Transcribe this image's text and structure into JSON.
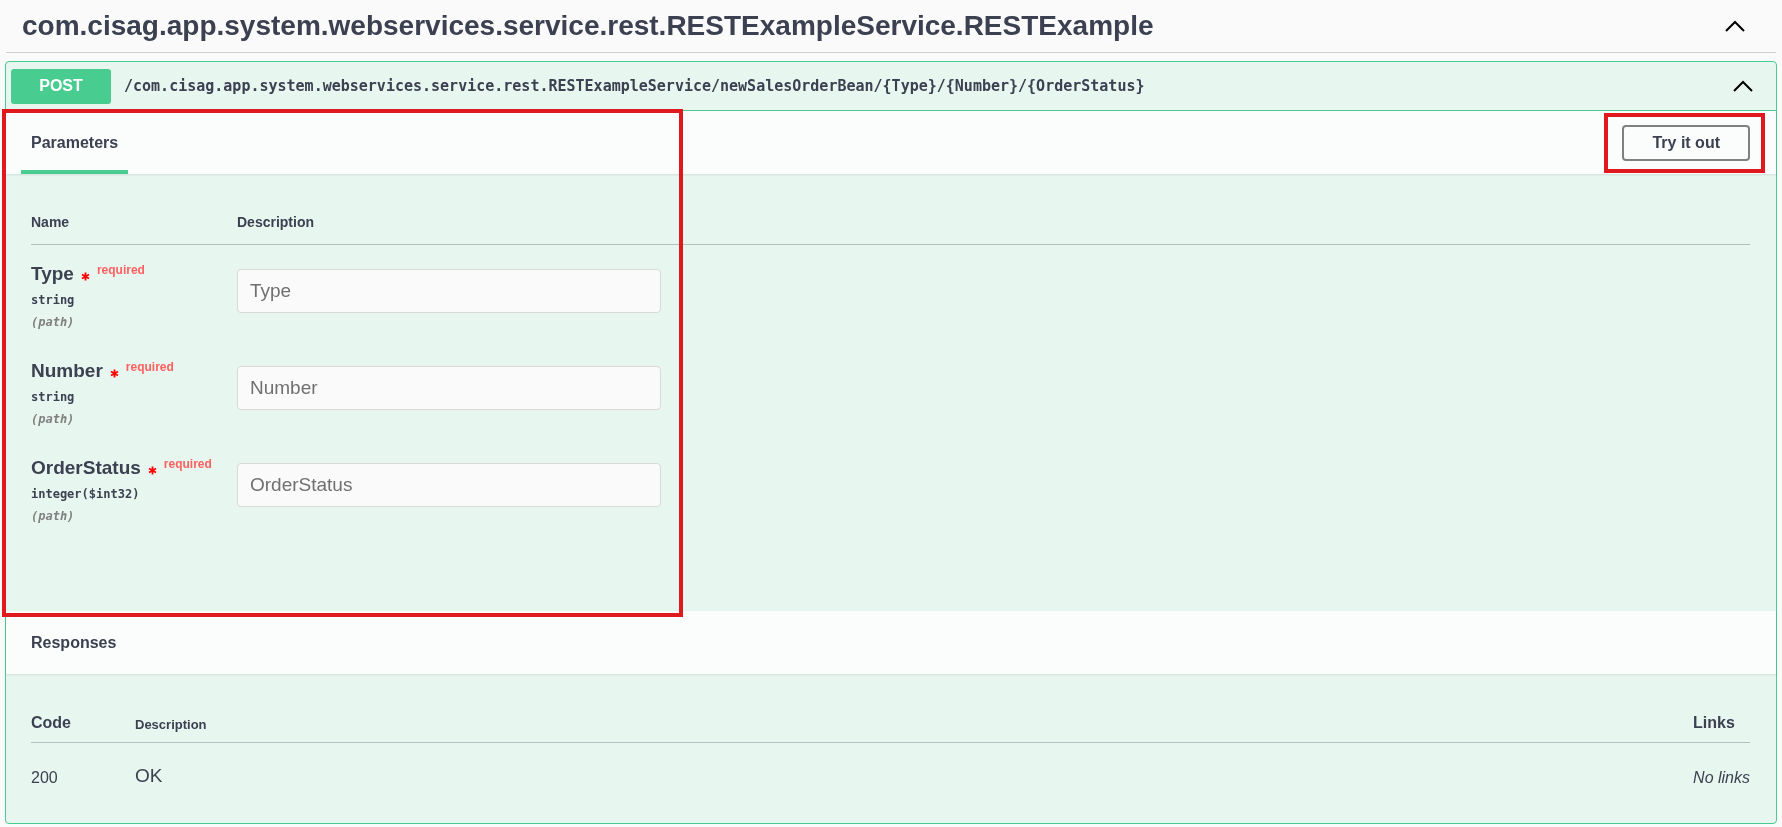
{
  "section": {
    "title": "com.cisag.app.system.webservices.service.rest.RESTExampleService.RESTExample",
    "expanded": true
  },
  "operation": {
    "method": "POST",
    "path": "/com.cisag.app.system.webservices.service.rest.RESTExampleService/newSalesOrderBean/{Type}/{Number}/{OrderStatus}",
    "expanded": true
  },
  "parameters": {
    "tab": {
      "label": "Parameters",
      "selected": true
    },
    "try_button": "Try it out",
    "columns": [
      "Name",
      "Description"
    ],
    "rows": [
      {
        "name": "Type",
        "required": true,
        "required_label": "required",
        "type": "string",
        "location": "(path)",
        "placeholder": "Type"
      },
      {
        "name": "Number",
        "required": true,
        "required_label": "required",
        "type": "string",
        "location": "(path)",
        "placeholder": "Number"
      },
      {
        "name": "OrderStatus",
        "required": true,
        "required_label": "required",
        "type": "integer($int32)",
        "location": "(path)",
        "placeholder": "OrderStatus"
      }
    ]
  },
  "responses": {
    "title": "Responses",
    "columns": [
      "Code",
      "Description",
      "Links"
    ],
    "rows": [
      {
        "code": "200",
        "description": "OK",
        "links": "No links"
      }
    ]
  }
}
